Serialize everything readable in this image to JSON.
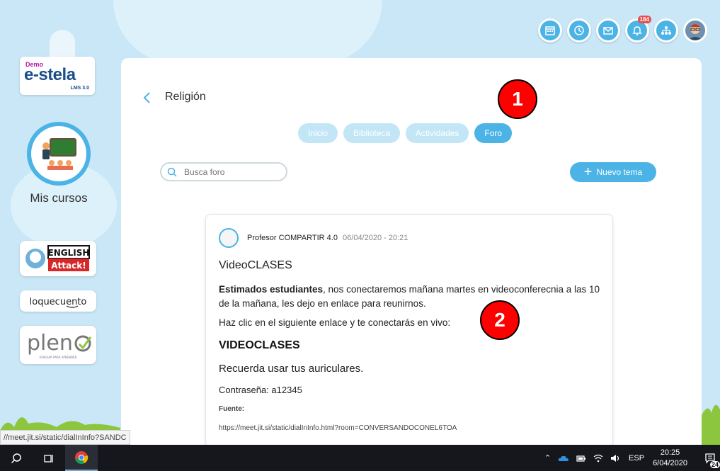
{
  "logo": {
    "demo": "Demo",
    "brand": "e-stela",
    "version": "LMS 3.0"
  },
  "sidebar": {
    "courses_label": "Mis cursos",
    "apps": [
      {
        "name": "English Attack!"
      },
      {
        "name": "loquecuento"
      },
      {
        "name": "pleno",
        "tagline": "EVALUAR PARA APRENDER"
      }
    ]
  },
  "header": {
    "icons": [
      "calendar-icon",
      "clock-icon",
      "mail-icon",
      "bell-icon",
      "org-chart-icon"
    ],
    "notification_count": "184"
  },
  "course": {
    "title": "Religión",
    "tabs": [
      {
        "label": "Inicio",
        "active": false
      },
      {
        "label": "Biblioteca",
        "active": false
      },
      {
        "label": "Actividades",
        "active": false
      },
      {
        "label": "Foro",
        "active": true
      }
    ],
    "search_placeholder": "Busca foro",
    "new_topic_label": "Nuevo tema"
  },
  "post": {
    "author": "Profesor COMPARTIR 4.0",
    "date": "06/04/2020 - 20:21",
    "title": "VideoCLASES",
    "body_bold": "Estimados estudiantes",
    "body_rest": ", nos conectaremos mañana martes en videoconferecnia a las 10 de la mañana, les dejo en enlace para reunirnos.",
    "link_line": "Haz clic en el siguiente enlace y te conectarás en vivo:",
    "link_title": "VIDEOCLASES",
    "reminder": "Recuerda usar tus auriculares.",
    "password": "Contraseña: a12345",
    "source_label": "Fuente:",
    "source_url": "https://meet.jit.si/static/dialInInfo.html?room=CONVERSANDOCONEL6TOA"
  },
  "markers": [
    "1",
    "2"
  ],
  "status_url": "//meet.jit.si/static/dialInInfo?SANDC",
  "taskbar": {
    "language": "ESP",
    "time": "20:25",
    "date": "6/04/2020",
    "notification_count": "24"
  }
}
